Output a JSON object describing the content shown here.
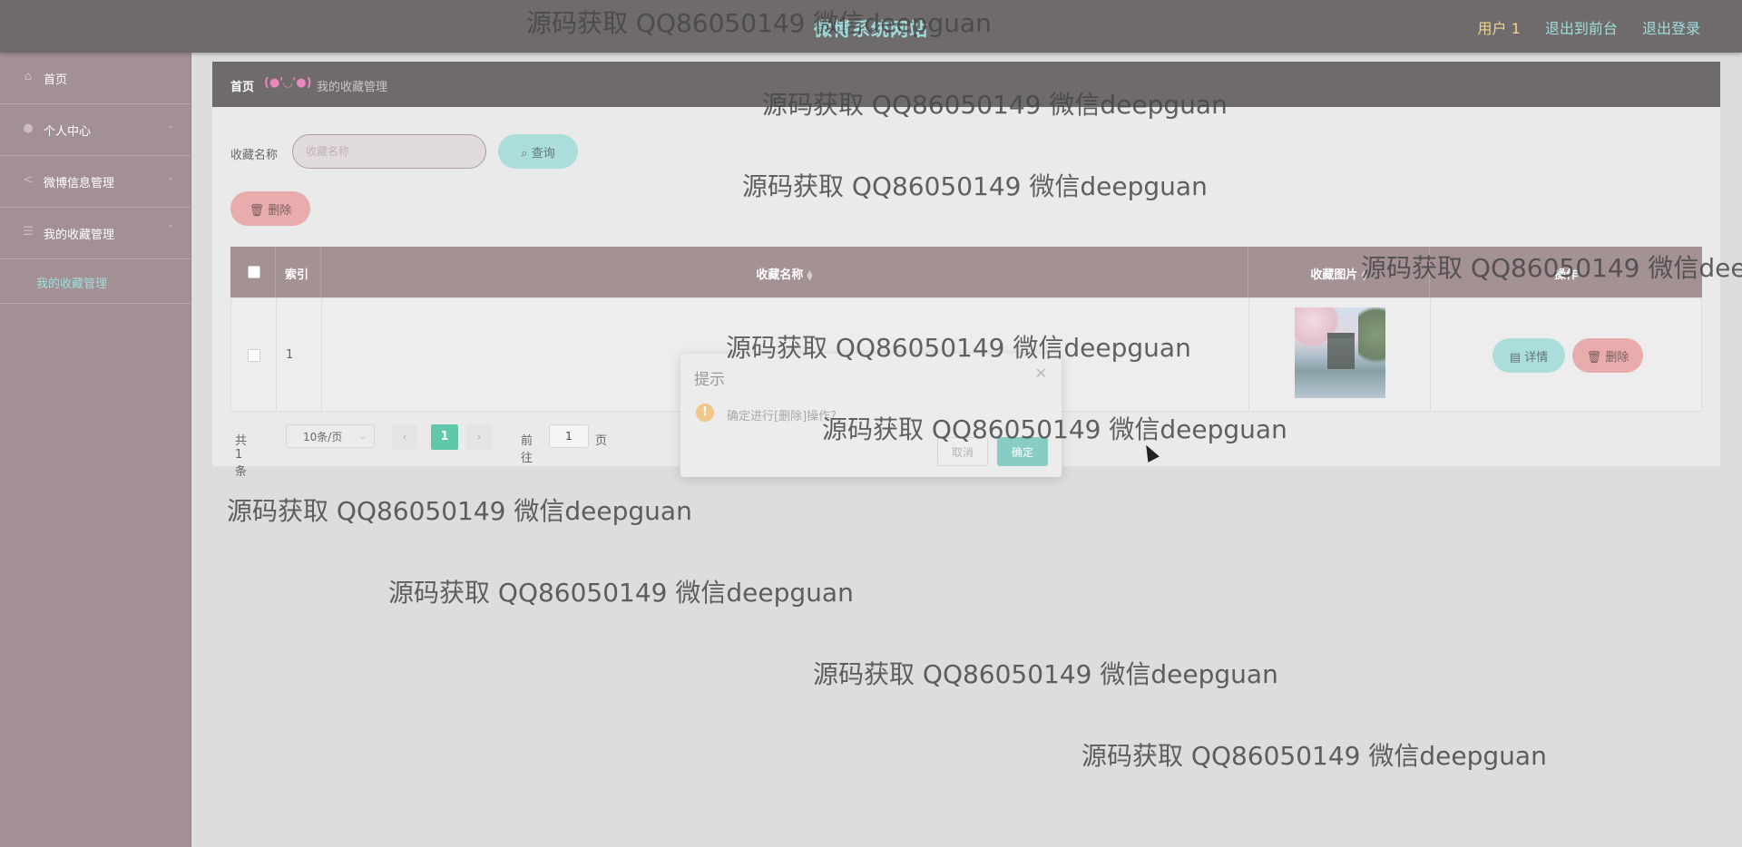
{
  "header": {
    "site_title": "微博系统网站",
    "user_name": "用户 1",
    "back_front_link": "退出到前台",
    "logout_link": "退出登录"
  },
  "sidebar": {
    "items": [
      {
        "label": "首页",
        "icon": "home-icon"
      },
      {
        "label": "个人中心",
        "icon": "user-icon"
      },
      {
        "label": "微博信息管理",
        "icon": "share-icon"
      },
      {
        "label": "我的收藏管理",
        "icon": "list-icon"
      }
    ],
    "sub_item": "我的收藏管理"
  },
  "breadcrumb": {
    "home": "首页",
    "separator": "(●'◡'●)",
    "current": "我的收藏管理"
  },
  "search": {
    "label": "收藏名称",
    "placeholder": "收藏名称",
    "button": "查询"
  },
  "toolbar": {
    "delete_button": "删除"
  },
  "table": {
    "columns": [
      "索引",
      "收藏名称",
      "收藏图片",
      "操作"
    ],
    "rows": [
      {
        "index": "1",
        "name": "",
        "detail_button": "详情",
        "delete_button": "删除"
      }
    ]
  },
  "pagination": {
    "total": "共 1 条",
    "page_size": "10条/页",
    "current_page": "1",
    "goto_prefix": "前往",
    "goto_value": "1",
    "goto_suffix": "页"
  },
  "dialog": {
    "title": "提示",
    "message": "确定进行[删除]操作?",
    "cancel": "取消",
    "confirm": "确定"
  },
  "watermark": "源码获取 QQ86050149 微信deepguan",
  "colors": {
    "header_bg": "#3f393b",
    "sidebar_bg": "#856b70",
    "accent_teal": "#8fd3cf",
    "danger_pink": "#e09092",
    "pager_active": "#2bb58f"
  }
}
